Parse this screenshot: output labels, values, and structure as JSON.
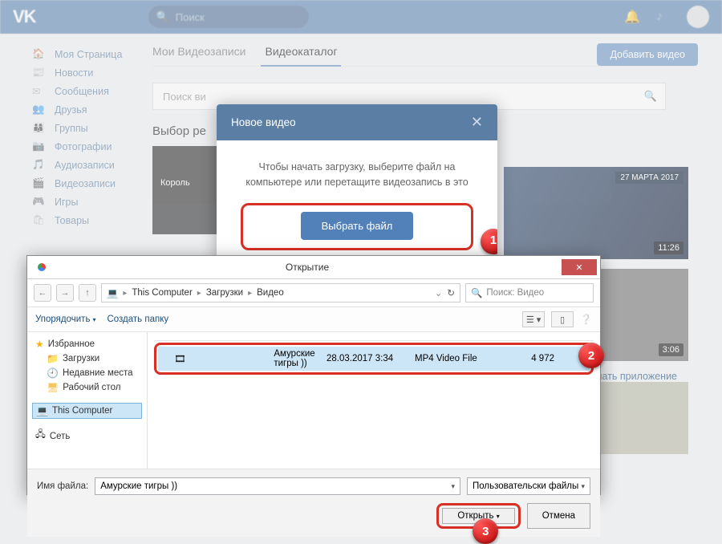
{
  "header": {
    "logo": "VK",
    "search_placeholder": "Поиск"
  },
  "sidebar": {
    "items": [
      {
        "icon": "🏠",
        "label": "Моя Страница"
      },
      {
        "icon": "📰",
        "label": "Новости"
      },
      {
        "icon": "✉",
        "label": "Сообщения"
      },
      {
        "icon": "👥",
        "label": "Друзья"
      },
      {
        "icon": "👨‍👩‍👦",
        "label": "Группы"
      },
      {
        "icon": "📷",
        "label": "Фотографии"
      },
      {
        "icon": "🎵",
        "label": "Аудиозаписи"
      },
      {
        "icon": "🎬",
        "label": "Видеозаписи"
      },
      {
        "icon": "🎮",
        "label": "Игры"
      },
      {
        "icon": "🛍",
        "label": "Товары"
      }
    ]
  },
  "main": {
    "tabs": {
      "t1": "Мои Видеозаписи",
      "t2": "Видеокаталог"
    },
    "add_button": "Добавить видео",
    "search_placeholder": "Поиск ви",
    "section": "Выбор ре",
    "thumb1_caption": "Король",
    "thumb3_date": "27 МАРТА 2017",
    "thumb3_badge": "11:26",
    "thumb4_badge": "3:06",
    "app_link": "чать приложение"
  },
  "modal": {
    "title": "Новое видео",
    "body": "Чтобы начать загрузку, выберите файл на компьютере или перетащите видеозапись в это",
    "button": "Выбрать файл"
  },
  "callouts": {
    "c1": "1",
    "c2": "2",
    "c3": "3"
  },
  "file_dialog": {
    "title": "Открытие",
    "nav": {
      "back": "←",
      "fwd": "→",
      "up": "↑"
    },
    "breadcrumb": {
      "p1": "This Computer",
      "p2": "Загрузки",
      "p3": "Видео"
    },
    "search_placeholder": "Поиск: Видео",
    "organize": "Упорядочить",
    "new_folder": "Создать папку",
    "tree": {
      "favorites": "Избранное",
      "downloads": "Загрузки",
      "recent": "Недавние места",
      "desktop": "Рабочий стол",
      "this_pc": "This Computer",
      "network": "Сеть"
    },
    "row": {
      "name": "Амурские тигры ))",
      "date": "28.03.2017 3:34",
      "type": "MP4 Video File",
      "size": "4 972"
    },
    "filename_label": "Имя файла:",
    "filename_value": "Амурские тигры ))",
    "filter": "Пользовательски файлы",
    "open": "Открыть",
    "cancel": "Отмена"
  }
}
